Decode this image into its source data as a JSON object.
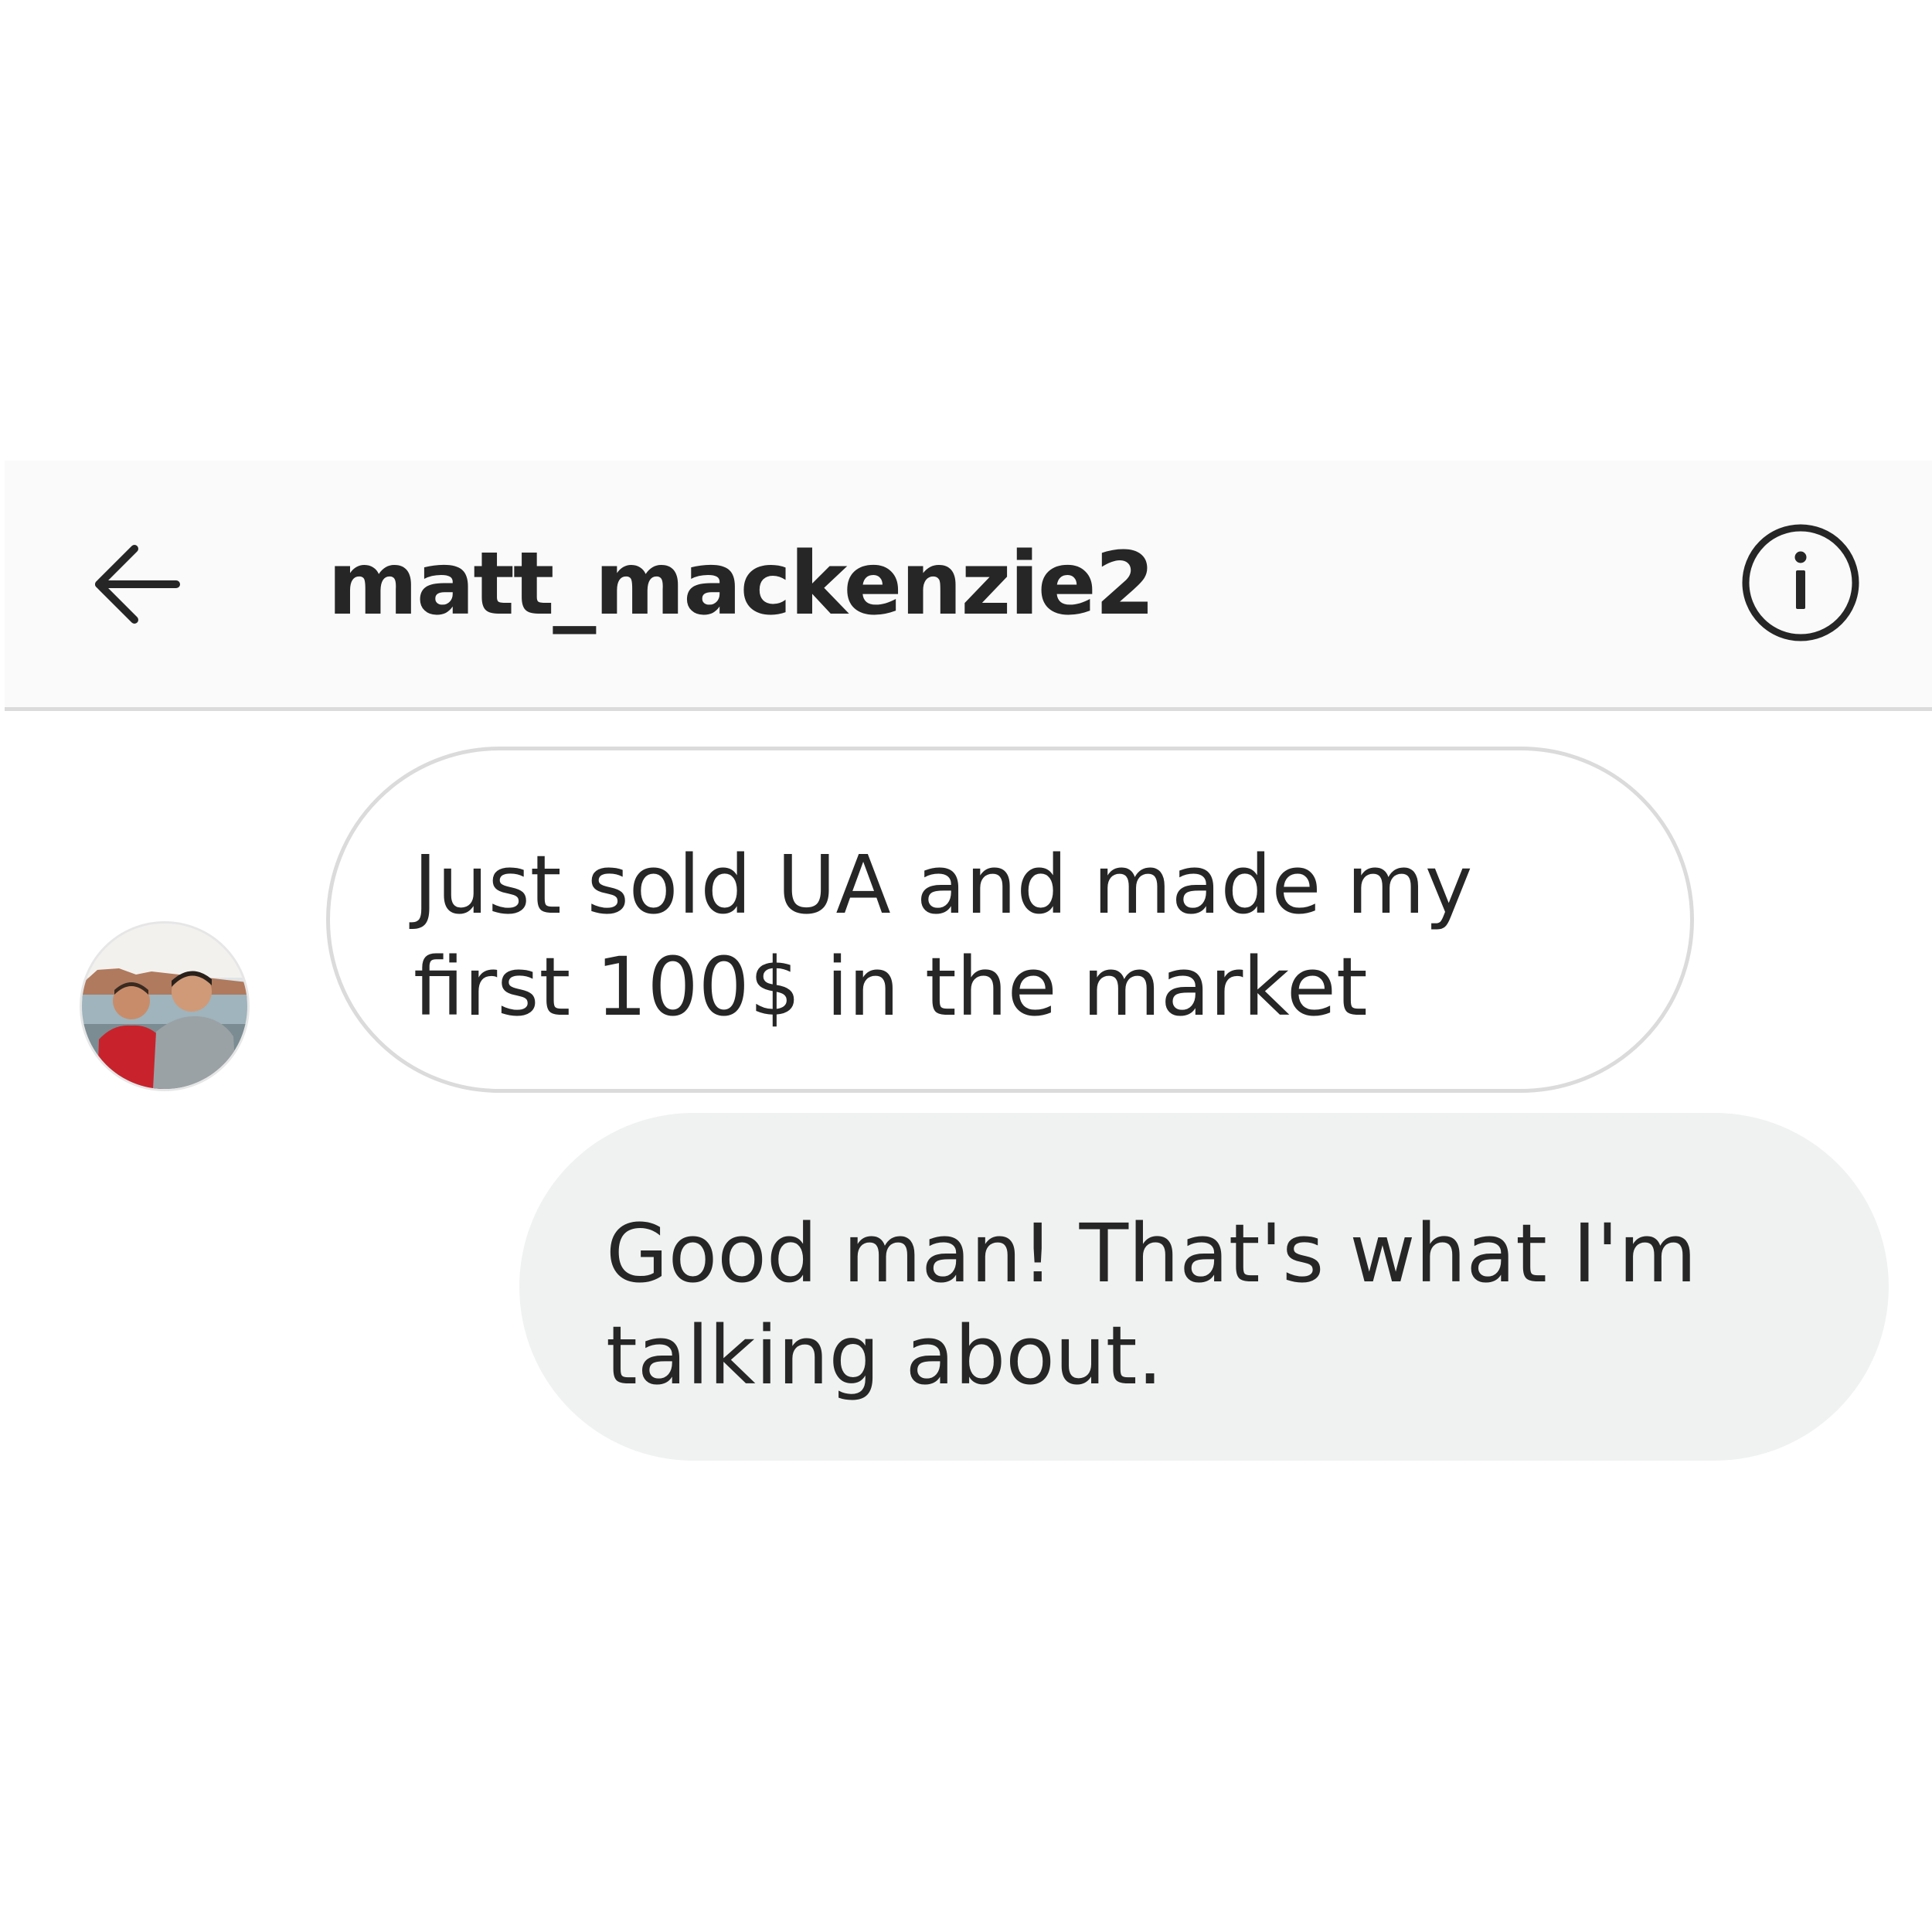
{
  "header": {
    "title": "matt_mackenzie2",
    "back_icon": "arrow-left-icon",
    "info_icon": "info-circle-icon"
  },
  "conversation": {
    "contact_avatar": "contact-avatar-photo",
    "messages": [
      {
        "direction": "incoming",
        "text": "Just sold UA and made my first 100$ in the market"
      },
      {
        "direction": "outgoing",
        "text": "Good man! That's what I'm talking about."
      }
    ]
  },
  "colors": {
    "header_bg": "#fafafa",
    "divider": "#dbdbdb",
    "text": "#262626",
    "incoming_border": "#dbdbdb",
    "outgoing_bg": "#f0f2f1"
  }
}
